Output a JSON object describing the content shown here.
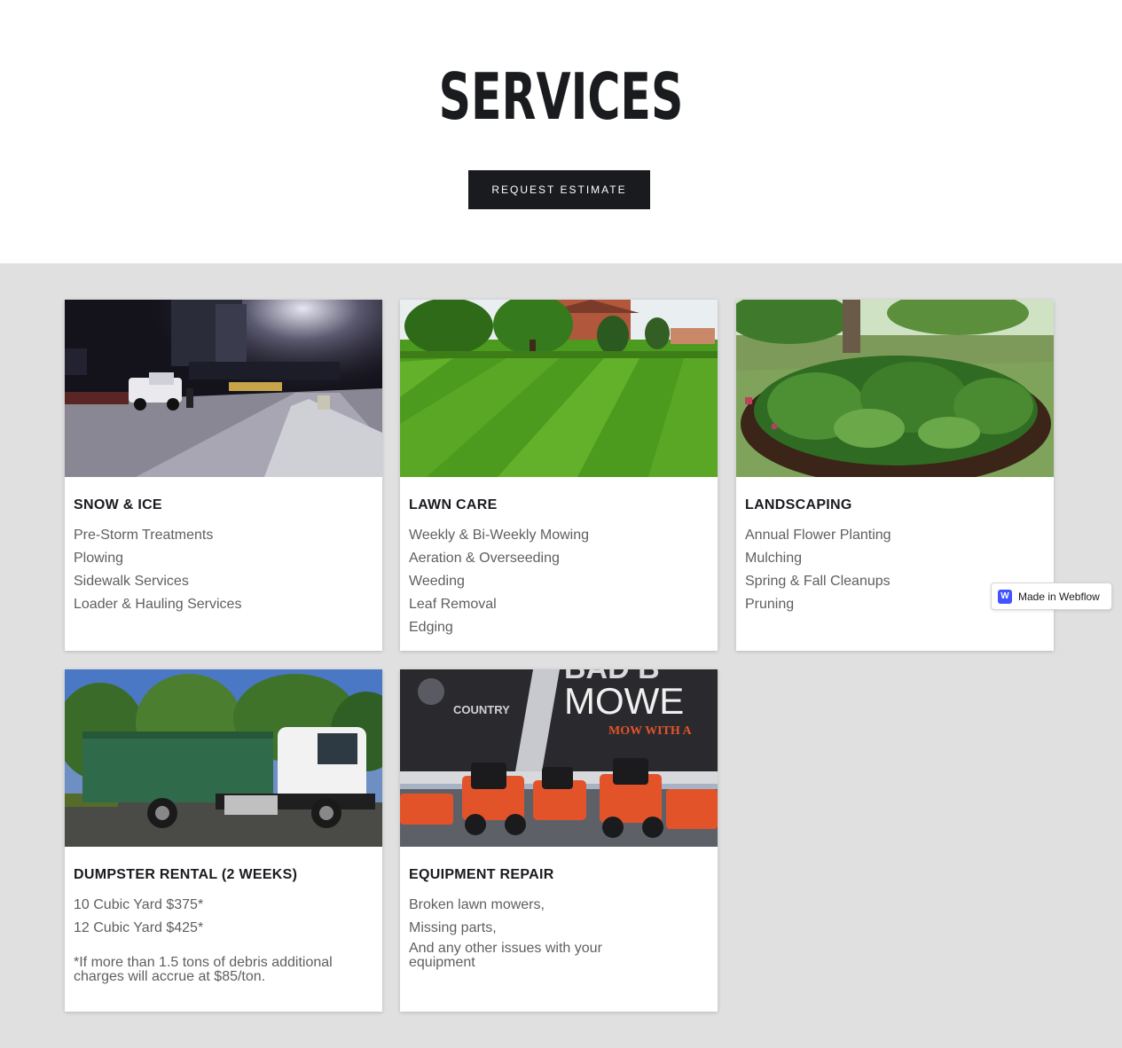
{
  "header": {
    "title": "SERVICES",
    "cta_label": "REQUEST ESTIMATE"
  },
  "services": [
    {
      "title": "SNOW & ICE",
      "image": "night-snow-plowing-photo",
      "lines": [
        "Pre-Storm Treatments",
        "Plowing",
        "Sidewalk Services",
        "Loader & Hauling Services"
      ]
    },
    {
      "title": "LAWN CARE",
      "image": "striped-lawn-photo",
      "lines": [
        "Weekly & Bi-Weekly Mowing",
        "Aeration & Overseeding",
        "Weeding",
        "Leaf Removal",
        "Edging"
      ]
    },
    {
      "title": "LANDSCAPING",
      "image": "hosta-flower-bed-photo",
      "lines": [
        "Annual Flower Planting",
        "Mulching",
        "Spring & Fall Cleanups",
        "Pruning"
      ]
    },
    {
      "title": "DUMPSTER RENTAL (2 WEEKS)",
      "image": "dumpster-truck-photo",
      "lines": [
        "10 Cubic Yard $375*",
        "12 Cubic Yard $425*"
      ],
      "note": "*If more than 1.5 tons of debris additional charges will accrue at $85/ton."
    },
    {
      "title": "EQUIPMENT REPAIR",
      "image": "red-zero-turn-mowers-photo",
      "lines": [
        "Broken lawn mowers,",
        "Missing parts,"
      ],
      "note": "And any other issues with your equipment",
      "banner_text": "MOWE",
      "banner_sub": "MOW WITH A",
      "banner_country": "COUNTRY",
      "banner_top": "BAD B"
    }
  ],
  "badge": {
    "label": "Made in Webflow",
    "logo": "W"
  },
  "colors": {
    "dark": "#1a1b1f",
    "section_bg": "#e0e0e0",
    "body_text": "#5f5f63",
    "webflow_blue": "#4353ff"
  }
}
